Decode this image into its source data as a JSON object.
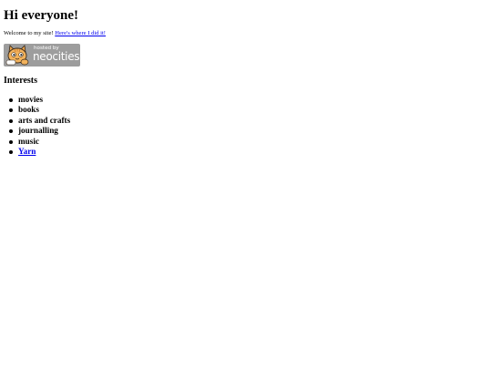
{
  "page": {
    "heading": "Hi everyone!",
    "welcome_text": "Welcome to my site!",
    "welcome_link": "Here's where I did it!"
  },
  "badge": {
    "small_text": "hosted by",
    "brand_text": "neocities"
  },
  "interests": {
    "title": "Interests",
    "items": [
      {
        "label": "movies",
        "link": false
      },
      {
        "label": "books",
        "link": false
      },
      {
        "label": "arts and crafts",
        "link": false
      },
      {
        "label": "journalling",
        "link": false
      },
      {
        "label": "music",
        "link": false
      },
      {
        "label": "Yarn",
        "link": true
      }
    ]
  },
  "colors": {
    "link": "#0000ee",
    "badge_bg": "#9d9d9d",
    "text": "#000000",
    "background": "#ffffff"
  }
}
